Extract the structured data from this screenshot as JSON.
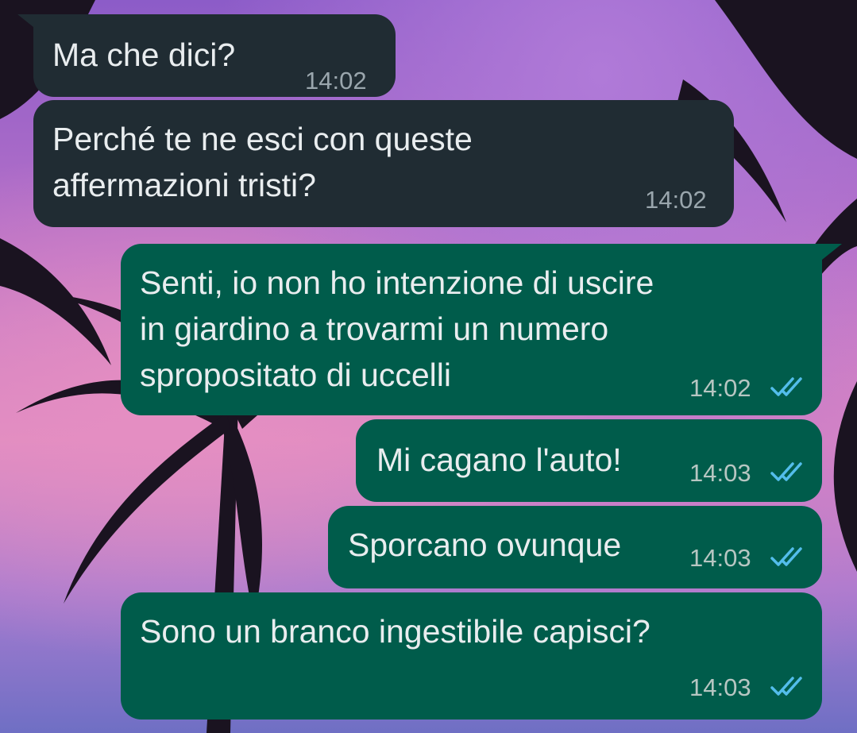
{
  "accent": {
    "incoming_bubble": "#202c33",
    "outgoing_bubble": "#005c4b",
    "read_ticks": "#53bdeb"
  },
  "messages": [
    {
      "direction": "incoming",
      "text": "Ma che dici?",
      "time": "14:02"
    },
    {
      "direction": "incoming",
      "text": "Perché te ne esci con queste\naffermazioni tristi?",
      "time": "14:02"
    },
    {
      "direction": "outgoing",
      "text": "Senti, io non ho intenzione di uscire\nin giardino a trovarmi un numero\nspropositato di uccelli",
      "time": "14:02",
      "status_icon": "double-check-read-icon"
    },
    {
      "direction": "outgoing",
      "text": "Mi cagano l'auto!",
      "time": "14:03",
      "status_icon": "double-check-read-icon"
    },
    {
      "direction": "outgoing",
      "text": "Sporcano ovunque",
      "time": "14:03",
      "status_icon": "double-check-read-icon"
    },
    {
      "direction": "outgoing",
      "text": "Sono un branco ingestibile capisci?",
      "time": "14:03",
      "status_icon": "double-check-read-icon"
    }
  ]
}
